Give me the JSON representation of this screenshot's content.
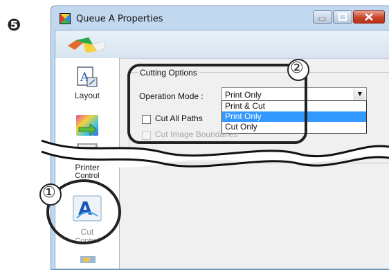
{
  "step": "❺",
  "window": {
    "title": "Queue A Properties",
    "icon": "queue-properties-icon",
    "buttons": [
      "minimize-icon",
      "maximize-icon",
      "close-icon"
    ],
    "accent": "#c6452b"
  },
  "sidebar": {
    "items": [
      {
        "label": "Layout",
        "icon": "layout-icon"
      },
      {
        "label": "",
        "icon": "color-management-icon"
      },
      {
        "label": "Printer",
        "label2": "Control",
        "icon": "printer-control-icon"
      },
      {
        "label": "Cut",
        "label2": "Control",
        "icon": "cut-control-icon",
        "selected": true
      }
    ]
  },
  "cutting_options": {
    "legend": "Cutting Options",
    "operation_mode_label": "Operation Mode :",
    "operation_mode_value": "Print Only",
    "options": [
      "Print & Cut",
      "Print Only",
      "Cut Only"
    ],
    "selected_index": 1,
    "cut_all_paths": {
      "label": "Cut All Paths",
      "checked": false
    },
    "cut_image_bounds": {
      "label": "Cut Image Boundaries",
      "checked": false,
      "disabled": true
    }
  },
  "callouts": {
    "one": "①",
    "two": "②"
  },
  "colors": {
    "selection": "#3399ff",
    "callout": "#222222"
  }
}
